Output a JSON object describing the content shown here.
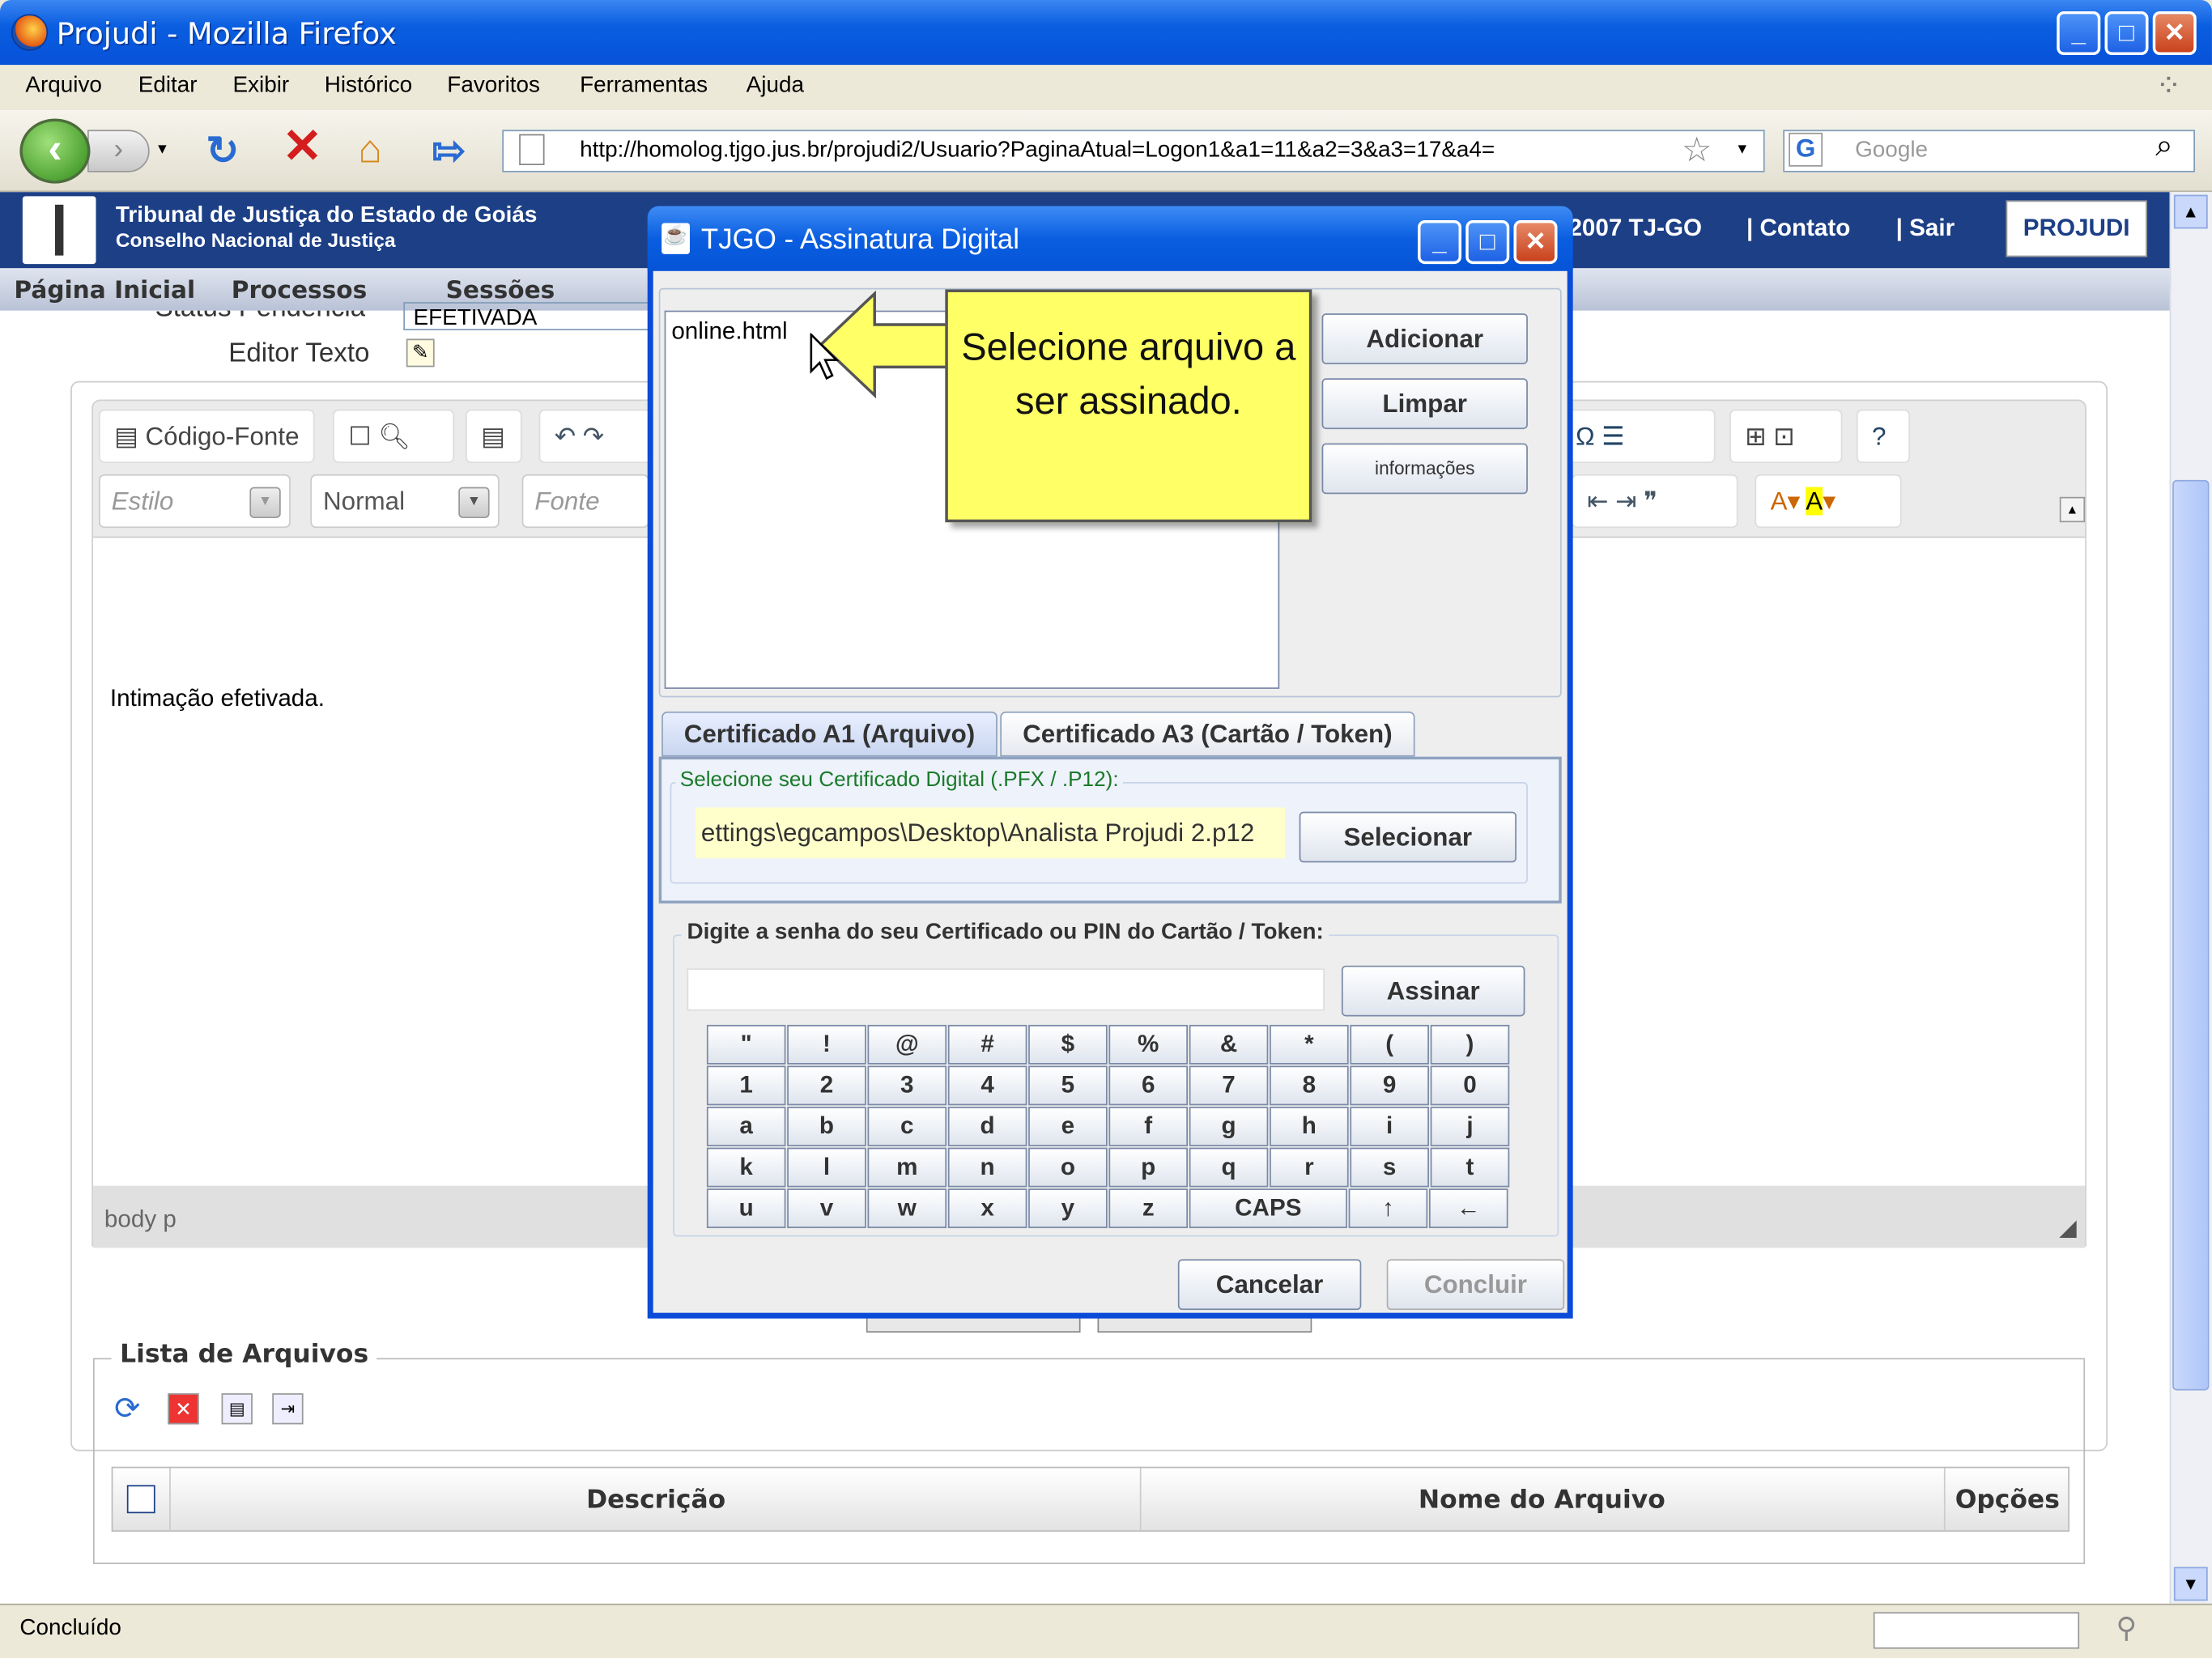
{
  "window": {
    "title": "Projudi - Mozilla Firefox"
  },
  "menubar": {
    "items": [
      "Arquivo",
      "Editar",
      "Exibir",
      "Histórico",
      "Favoritos",
      "Ferramentas",
      "Ajuda"
    ]
  },
  "navbar": {
    "url": "http://homolog.tjgo.jus.br/projudi2/Usuario?PaginaAtual=Logon1&a1=11&a2=3&a3=17&a4=",
    "search_placeholder": "Google"
  },
  "banner": {
    "line1": "Tribunal de Justiça do Estado de Goiás",
    "line2": "Conselho Nacional de Justiça",
    "copyright": "2007 TJ-GO",
    "contato": "Contato",
    "sair": "Sair",
    "logo_text": "PROJUDI"
  },
  "page_tabs": [
    "Página Inicial",
    "Processos",
    "Sessões"
  ],
  "form": {
    "status_label": "Status Pendência",
    "status_value": "EFETIVADA",
    "editor_label": "Editor Texto"
  },
  "editor": {
    "source_button": "Código-Fonte",
    "style_combo": "Estilo",
    "format_combo": "Normal",
    "font_combo": "Fonte",
    "content": "Intimação efetivada.",
    "path": "body  p"
  },
  "lista": {
    "legend": "Lista de Arquivos",
    "columns": [
      "Descrição",
      "Nome do Arquivo",
      "Opções"
    ]
  },
  "statusbar": {
    "text": "Concluído"
  },
  "dialog": {
    "title": "TJGO - Assinatura Digital",
    "file_group": "Selecione Arquivo a ser assinado:",
    "files": [
      "online.html"
    ],
    "btn_add": "Adicionar",
    "btn_clear": "Limpar",
    "btn_info": "informações",
    "tabs": [
      "Certificado A1 (Arquivo)",
      "Certificado A3 (Cartão / Token)"
    ],
    "cert_group": "Selecione seu Certificado Digital (.PFX / .P12):",
    "cert_path": "ettings\\egcampos\\Desktop\\Analista Projudi 2.p12",
    "btn_select": "Selecionar",
    "pin_group": "Digite a senha do seu Certificado ou PIN do Cartão / Token:",
    "btn_sign": "Assinar",
    "keys": [
      [
        "\"",
        "!",
        "@",
        "#",
        "$",
        "%",
        "&",
        "*",
        "(",
        ")"
      ],
      [
        "1",
        "2",
        "3",
        "4",
        "5",
        "6",
        "7",
        "8",
        "9",
        "0"
      ],
      [
        "a",
        "b",
        "c",
        "d",
        "e",
        "f",
        "g",
        "h",
        "i",
        "j"
      ],
      [
        "k",
        "l",
        "m",
        "n",
        "o",
        "p",
        "q",
        "r",
        "s",
        "t"
      ],
      [
        "u",
        "v",
        "w",
        "x",
        "y",
        "z",
        "CAPS",
        "↑",
        "←"
      ]
    ],
    "btn_cancel": "Cancelar",
    "btn_finish": "Concluir"
  },
  "callout": {
    "text": "Selecione arquivo a ser assinado."
  }
}
